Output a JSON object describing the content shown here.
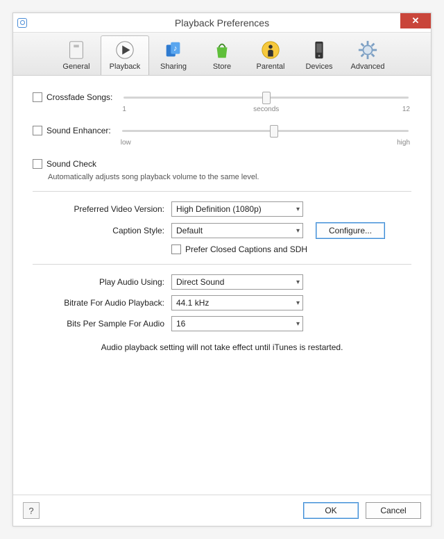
{
  "window": {
    "title": "Playback Preferences"
  },
  "tabs": {
    "items": [
      {
        "label": "General"
      },
      {
        "label": "Playback"
      },
      {
        "label": "Sharing"
      },
      {
        "label": "Store"
      },
      {
        "label": "Parental"
      },
      {
        "label": "Devices"
      },
      {
        "label": "Advanced"
      }
    ],
    "selected_index": 1
  },
  "crossfade": {
    "label": "Crossfade Songs:",
    "checked": false,
    "min_label": "1",
    "mid_label": "seconds",
    "max_label": "12",
    "thumb_pct": 50
  },
  "enhancer": {
    "label": "Sound Enhancer:",
    "checked": false,
    "min_label": "low",
    "max_label": "high",
    "thumb_pct": 53
  },
  "soundcheck": {
    "label": "Sound Check",
    "checked": false,
    "hint": "Automatically adjusts song playback volume to the same level."
  },
  "video": {
    "preferred_label": "Preferred Video Version:",
    "preferred_value": "High Definition (1080p)",
    "caption_label": "Caption Style:",
    "caption_value": "Default",
    "configure_label": "Configure...",
    "cc_label": "Prefer Closed Captions and SDH",
    "cc_checked": false
  },
  "audio": {
    "play_using_label": "Play Audio Using:",
    "play_using_value": "Direct Sound",
    "bitrate_label": "Bitrate For Audio Playback:",
    "bitrate_value": "44.1 kHz",
    "bits_label": "Bits Per Sample For Audio",
    "bits_value": "16",
    "note": "Audio playback setting will not take effect until iTunes is restarted."
  },
  "footer": {
    "help_label": "?",
    "ok_label": "OK",
    "cancel_label": "Cancel"
  }
}
